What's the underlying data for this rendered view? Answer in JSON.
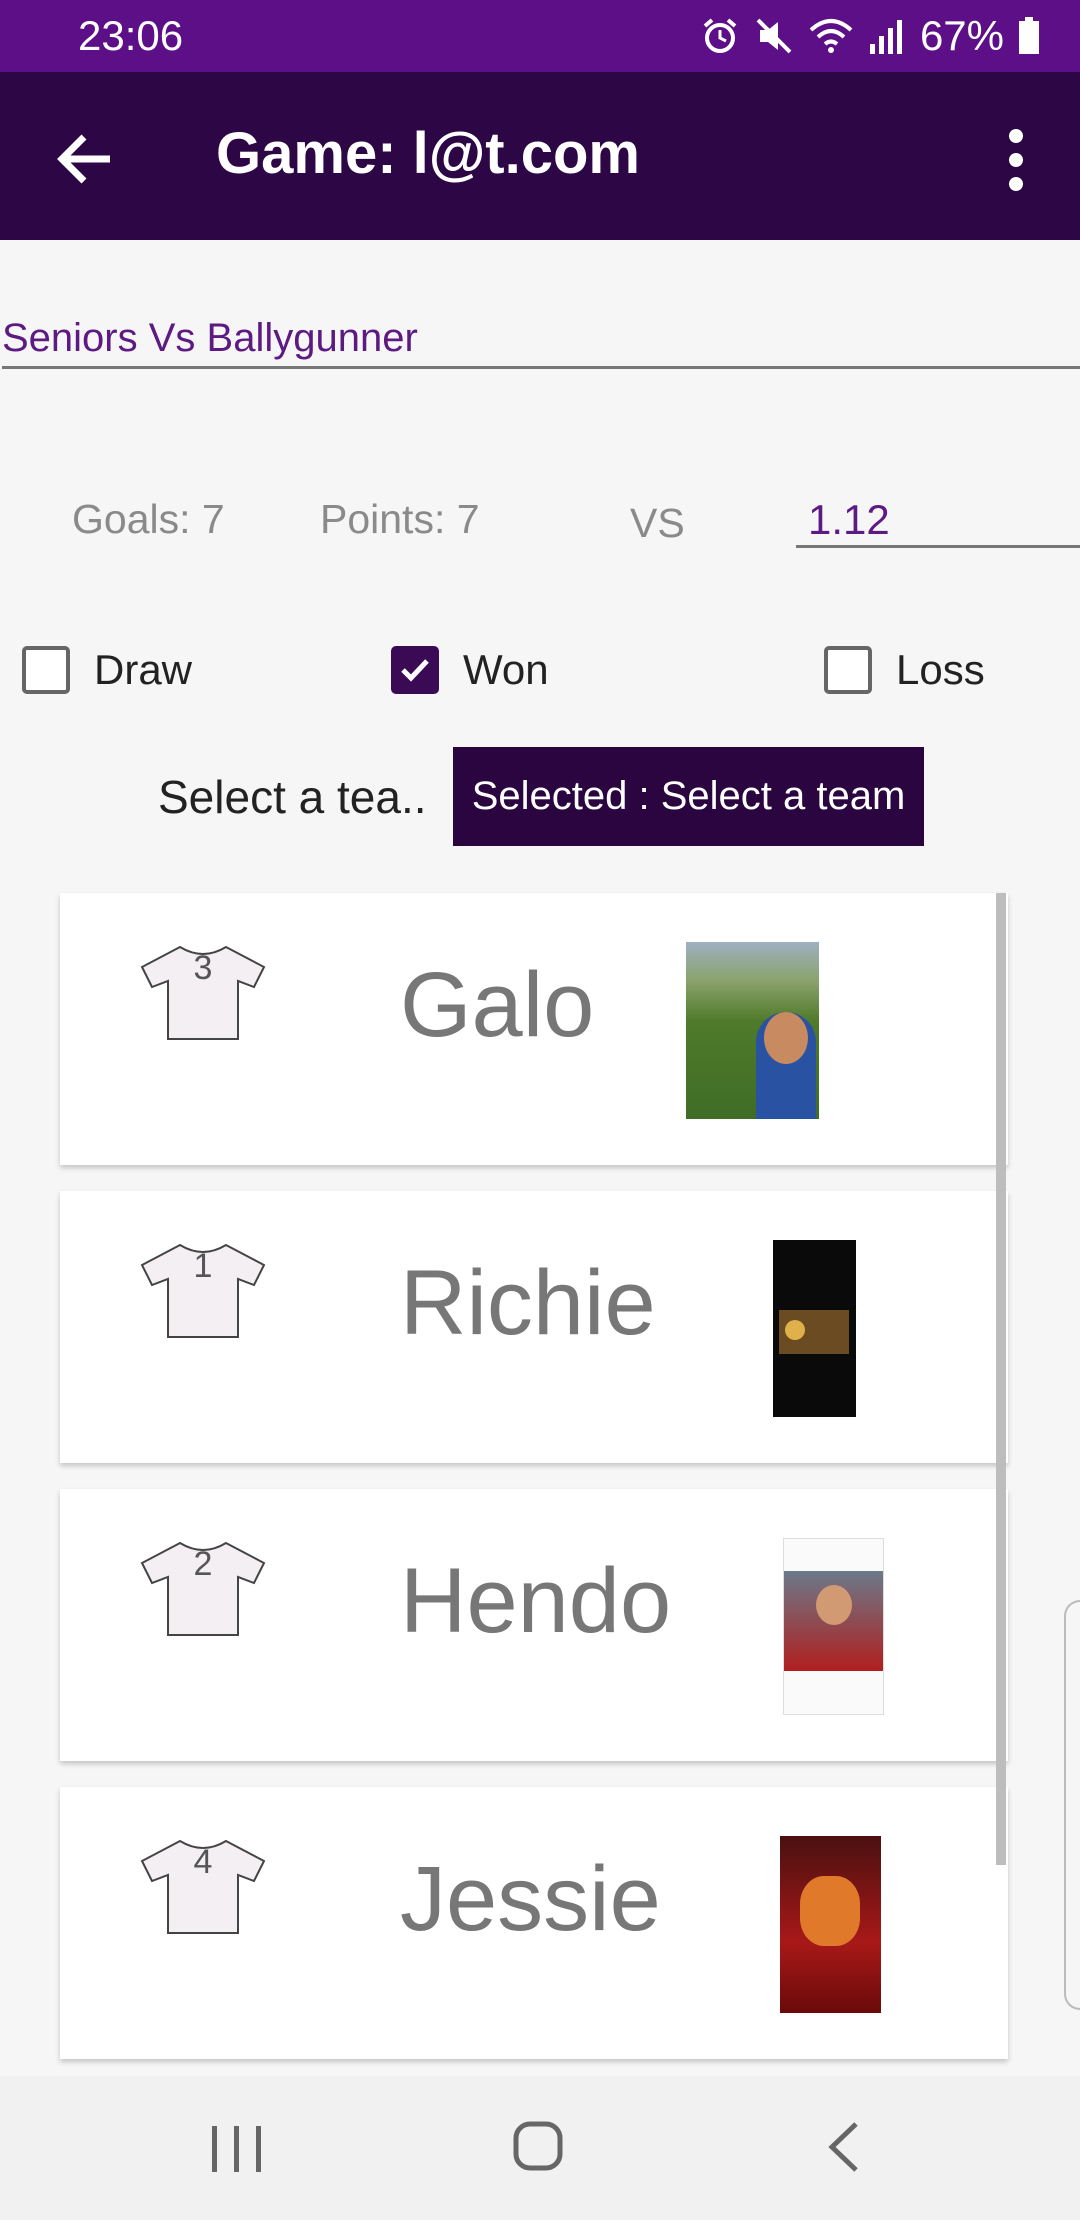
{
  "status_bar": {
    "time": "23:06",
    "battery": "67%"
  },
  "app_bar": {
    "title": "Game: l@t.com"
  },
  "game": {
    "name": "Seniors Vs Ballygunner"
  },
  "score": {
    "goals": "Goals: 7",
    "points": "Points: 7",
    "vs": "VS",
    "opponent_score": "1.12"
  },
  "result": {
    "draw": {
      "label": "Draw",
      "checked": false
    },
    "won": {
      "label": "Won",
      "checked": true
    },
    "loss": {
      "label": "Loss",
      "checked": false
    }
  },
  "team_select": {
    "label": "Select a tea..",
    "button": "Selected : Select a team"
  },
  "players": [
    {
      "number": "3",
      "name": "Galo"
    },
    {
      "number": "1",
      "name": "Richie"
    },
    {
      "number": "2",
      "name": "Hendo"
    },
    {
      "number": "4",
      "name": "Jessie"
    }
  ],
  "colors": {
    "status_bar": "#5d0f87",
    "app_bar": "#2d0645",
    "accent": "#5c1a82"
  },
  "icons": [
    "back-arrow-icon",
    "more-vert-icon",
    "alarm-icon",
    "mute-icon",
    "wifi-icon",
    "signal-icon",
    "battery-icon",
    "shirt-icon",
    "recent-apps-icon",
    "home-icon",
    "nav-back-icon"
  ]
}
